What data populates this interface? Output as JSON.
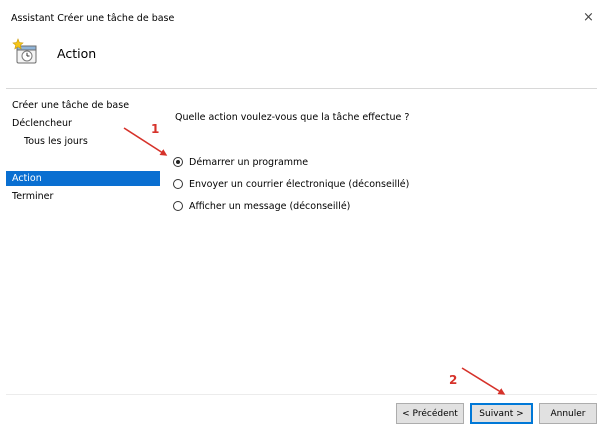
{
  "window": {
    "title": "Assistant Créer une tâche de base",
    "close_glyph": "×"
  },
  "header": {
    "heading": "Action",
    "icon": "scheduled-task-icon"
  },
  "sidebar": {
    "items": [
      {
        "label": "Créer une tâche de base"
      },
      {
        "label": "Déclencheur"
      },
      {
        "label": "Tous les jours"
      },
      {
        "label": "Action"
      },
      {
        "label": "Terminer"
      }
    ],
    "active_index": 3
  },
  "content": {
    "question": "Quelle action voulez-vous que la tâche effectue ?",
    "options": [
      {
        "label": "Démarrer un programme",
        "checked": true
      },
      {
        "label": "Envoyer un courrier électronique (déconseillé)",
        "checked": false
      },
      {
        "label": "Afficher un message (déconseillé)",
        "checked": false
      }
    ]
  },
  "footer": {
    "back_label": "< Précédent",
    "next_label": "Suivant >",
    "cancel_label": "Annuler"
  },
  "annotations": {
    "step1": "1",
    "step2": "2",
    "color": "#d6322a"
  },
  "colors": {
    "selection": "#0a6fd1",
    "focus_border": "#0078d7"
  }
}
